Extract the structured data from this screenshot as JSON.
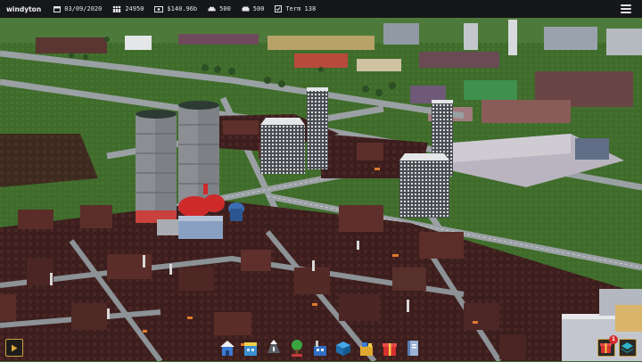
{
  "topbar": {
    "city_name": "windyton",
    "date": "03/09/2020",
    "population": "24950",
    "money": "$140.96b",
    "stat_a": "500",
    "stat_b": "500",
    "term": "Term 138"
  },
  "icons": {
    "date": "calendar-icon",
    "population": "people-icon",
    "money": "money-icon",
    "stat_a": "car-icon",
    "stat_b": "traffic-icon",
    "term": "checkbox-icon",
    "menu": "hamburger-menu-icon",
    "play": "play-icon"
  },
  "toolbar": {
    "tools": [
      {
        "name": "residential-tool",
        "icon": "house-blue-icon"
      },
      {
        "name": "commercial-tool",
        "icon": "shop-icon"
      },
      {
        "name": "road-tool",
        "icon": "road-arrows-icon"
      },
      {
        "name": "services-tool",
        "icon": "tree-icon"
      },
      {
        "name": "industry-tool",
        "icon": "factory-icon"
      },
      {
        "name": "utilities-tool",
        "icon": "utility-box-icon"
      },
      {
        "name": "special-tool",
        "icon": "construction-icon"
      },
      {
        "name": "gifts-tool",
        "icon": "gift-icon"
      },
      {
        "name": "info-tool",
        "icon": "book-icon"
      }
    ]
  },
  "bottom_right": {
    "gift_badge": "1"
  },
  "colors": {
    "bar_bg": "#15171a",
    "gold_border": "#caa143",
    "grass": "#3f6b2b",
    "road": "#9aa0a3",
    "roof_dark": "#3b1e1d",
    "cooling_tower": "#7d8185"
  }
}
